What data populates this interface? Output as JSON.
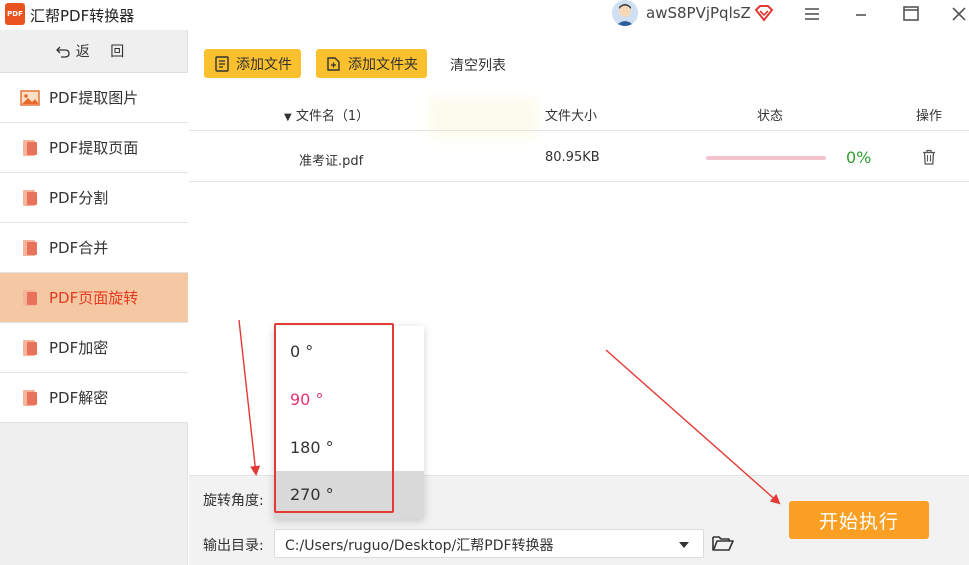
{
  "app": {
    "title": "汇帮PDF转换器",
    "logo_text": "PDF",
    "username": "awS8PVjPqlsZ"
  },
  "window_controls": {
    "menu_icon": "hamburger-icon",
    "minimize_icon": "minimize-icon",
    "maximize_icon": "maximize-icon",
    "close_icon": "close-icon"
  },
  "sidebar": {
    "back_label": "返 回",
    "items": [
      {
        "label": "PDF提取图片",
        "icon": "image-icon",
        "active": false
      },
      {
        "label": "PDF提取页面",
        "icon": "pdf-page-icon",
        "active": false
      },
      {
        "label": "PDF分割",
        "icon": "pdf-page-icon",
        "active": false
      },
      {
        "label": "PDF合并",
        "icon": "pdf-page-icon",
        "active": false
      },
      {
        "label": "PDF页面旋转",
        "icon": "pdf-page-icon",
        "active": true
      },
      {
        "label": "PDF加密",
        "icon": "pdf-page-icon",
        "active": false
      },
      {
        "label": "PDF解密",
        "icon": "pdf-page-icon",
        "active": false
      }
    ]
  },
  "toolbar": {
    "add_file_label": "添加文件",
    "add_folder_label": "添加文件夹",
    "clear_label": "清空列表"
  },
  "table": {
    "headers": {
      "name": "文件名（1）",
      "size": "文件大小",
      "status": "状态",
      "action": "操作"
    },
    "rows": [
      {
        "name": "准考证.pdf",
        "size": "80.95KB",
        "progress": 0,
        "percent": "0%"
      }
    ]
  },
  "settings": {
    "angle_label": "旋转角度:",
    "output_label": "输出目录:",
    "output_path": "C:/Users/ruguo/Desktop/汇帮PDF转换器",
    "angle_options": [
      "0 °",
      "90 °",
      "180 °",
      "270 °"
    ],
    "selected_angle": "90 °",
    "hovered_angle": "270 °"
  },
  "start_button_label": "开始执行",
  "colors": {
    "accent_yellow": "#fbc02d",
    "active_nav_bg": "#f5c8a4",
    "active_nav_text": "#e63a1e",
    "start_button": "#f9a024",
    "progress_green": "#2f9e2f",
    "selected_option": "#e8336a",
    "annotation_red": "#e53935"
  }
}
